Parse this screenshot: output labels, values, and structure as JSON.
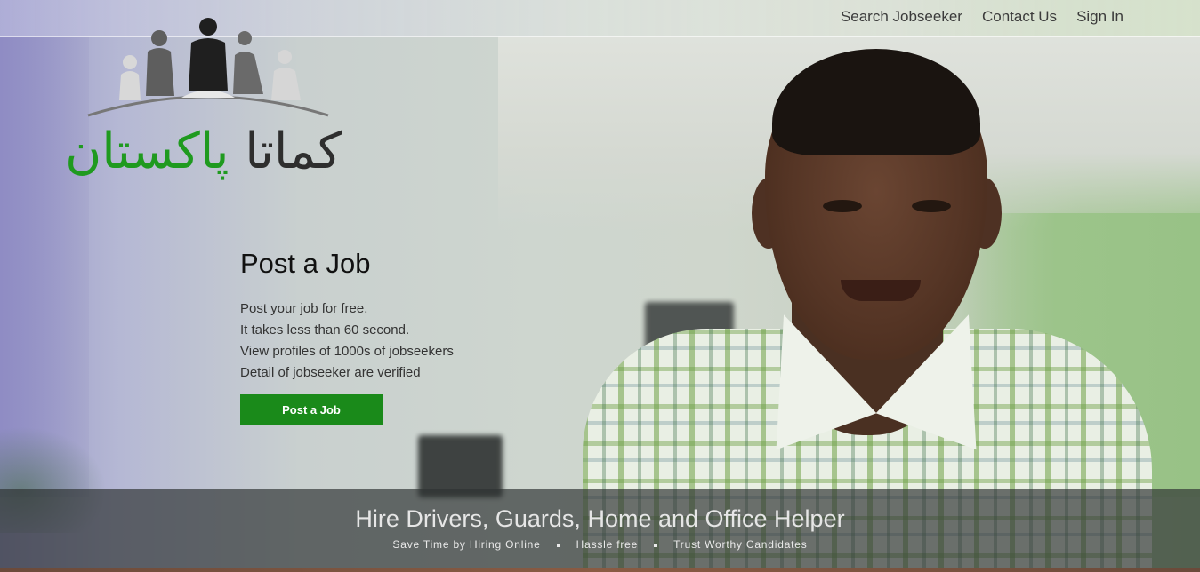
{
  "nav": {
    "items": [
      "Search Jobseeker",
      "Contact Us",
      "Sign In"
    ]
  },
  "logo": {
    "word1": "كماتا",
    "word2": "پاکستان"
  },
  "hero": {
    "title": "Post a Job",
    "lines": [
      "Post your job for free.",
      "It takes less than 60 second.",
      "View profiles of 1000s of jobseekers",
      "Detail of jobseeker are verified"
    ],
    "button_label": "Post a Job"
  },
  "banner": {
    "headline": "Hire Drivers, Guards, Home and Office Helper",
    "tags": [
      "Save Time by Hiring Online",
      "Hassle free",
      "Trust Worthy Candidates"
    ]
  },
  "colors": {
    "accent_green": "#1a8a1a",
    "logo_green": "#1f9a1f"
  }
}
